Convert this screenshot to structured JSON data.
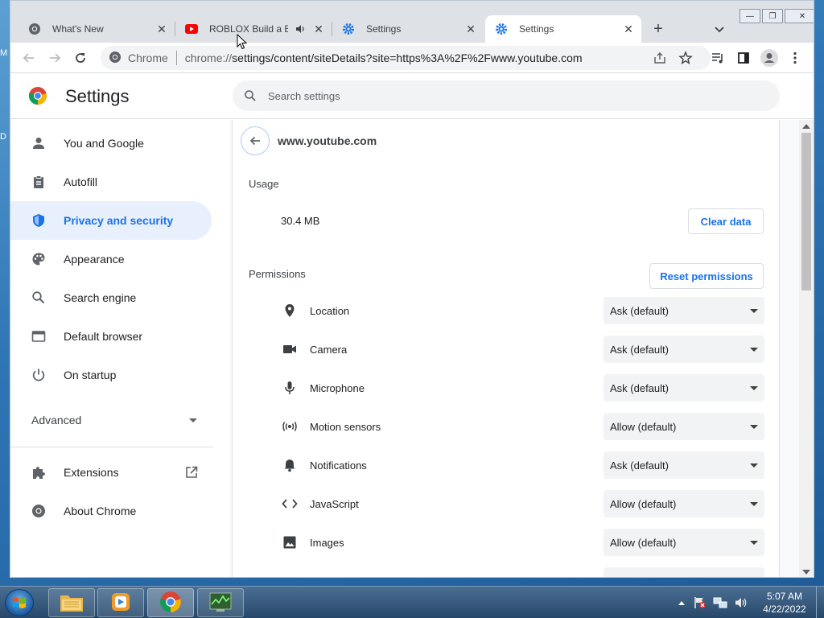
{
  "desktop": {
    "fragments": [
      "M",
      "D"
    ]
  },
  "browser": {
    "tabs": [
      {
        "title": "What's New",
        "icon": "chrome-icon",
        "active": false
      },
      {
        "title": "ROBLOX Build a Boat",
        "icon": "youtube-icon",
        "audio": true,
        "active": false
      },
      {
        "title": "Settings",
        "icon": "gear-icon",
        "active": false
      },
      {
        "title": "Settings",
        "icon": "gear-icon",
        "active": true
      }
    ],
    "close_glyph": "✕",
    "new_tab_glyph": "+",
    "window_buttons": {
      "minimize": "—",
      "maximize": "❐",
      "close": "✕"
    },
    "omnibox": {
      "chip": "Chrome",
      "url_prefix": "chrome://",
      "url_rest": "settings/content/siteDetails?site=https%3A%2F%2Fwww.youtube.com"
    }
  },
  "settings": {
    "title": "Settings",
    "search_placeholder": "Search settings",
    "nav": [
      {
        "label": "You and Google",
        "icon": "person-icon"
      },
      {
        "label": "Autofill",
        "icon": "clipboard-icon"
      },
      {
        "label": "Privacy and security",
        "icon": "shield-icon",
        "active": true
      },
      {
        "label": "Appearance",
        "icon": "palette-icon"
      },
      {
        "label": "Search engine",
        "icon": "search-icon"
      },
      {
        "label": "Default browser",
        "icon": "browser-icon"
      },
      {
        "label": "On startup",
        "icon": "power-icon"
      }
    ],
    "advanced_label": "Advanced",
    "extensions_label": "Extensions",
    "about_label": "About Chrome"
  },
  "site": {
    "host": "www.youtube.com",
    "usage_title": "Usage",
    "usage_value": "30.4 MB",
    "clear_data_label": "Clear data",
    "permissions_title": "Permissions",
    "reset_permissions_label": "Reset permissions",
    "permissions": [
      {
        "label": "Location",
        "value": "Ask (default)",
        "icon": "location-pin-icon"
      },
      {
        "label": "Camera",
        "value": "Ask (default)",
        "icon": "camera-icon"
      },
      {
        "label": "Microphone",
        "value": "Ask (default)",
        "icon": "microphone-icon"
      },
      {
        "label": "Motion sensors",
        "value": "Allow (default)",
        "icon": "motion-sensor-icon"
      },
      {
        "label": "Notifications",
        "value": "Ask (default)",
        "icon": "bell-icon"
      },
      {
        "label": "JavaScript",
        "value": "Allow (default)",
        "icon": "code-icon"
      },
      {
        "label": "Images",
        "value": "Allow (default)",
        "icon": "image-icon"
      }
    ]
  },
  "taskbar": {
    "time": "5:07 AM",
    "date": "4/22/2022"
  },
  "colors": {
    "accent": "#1a73e8",
    "active_nav_bg": "#e8f0fe",
    "tabstrip_bg": "#dee1e6"
  }
}
